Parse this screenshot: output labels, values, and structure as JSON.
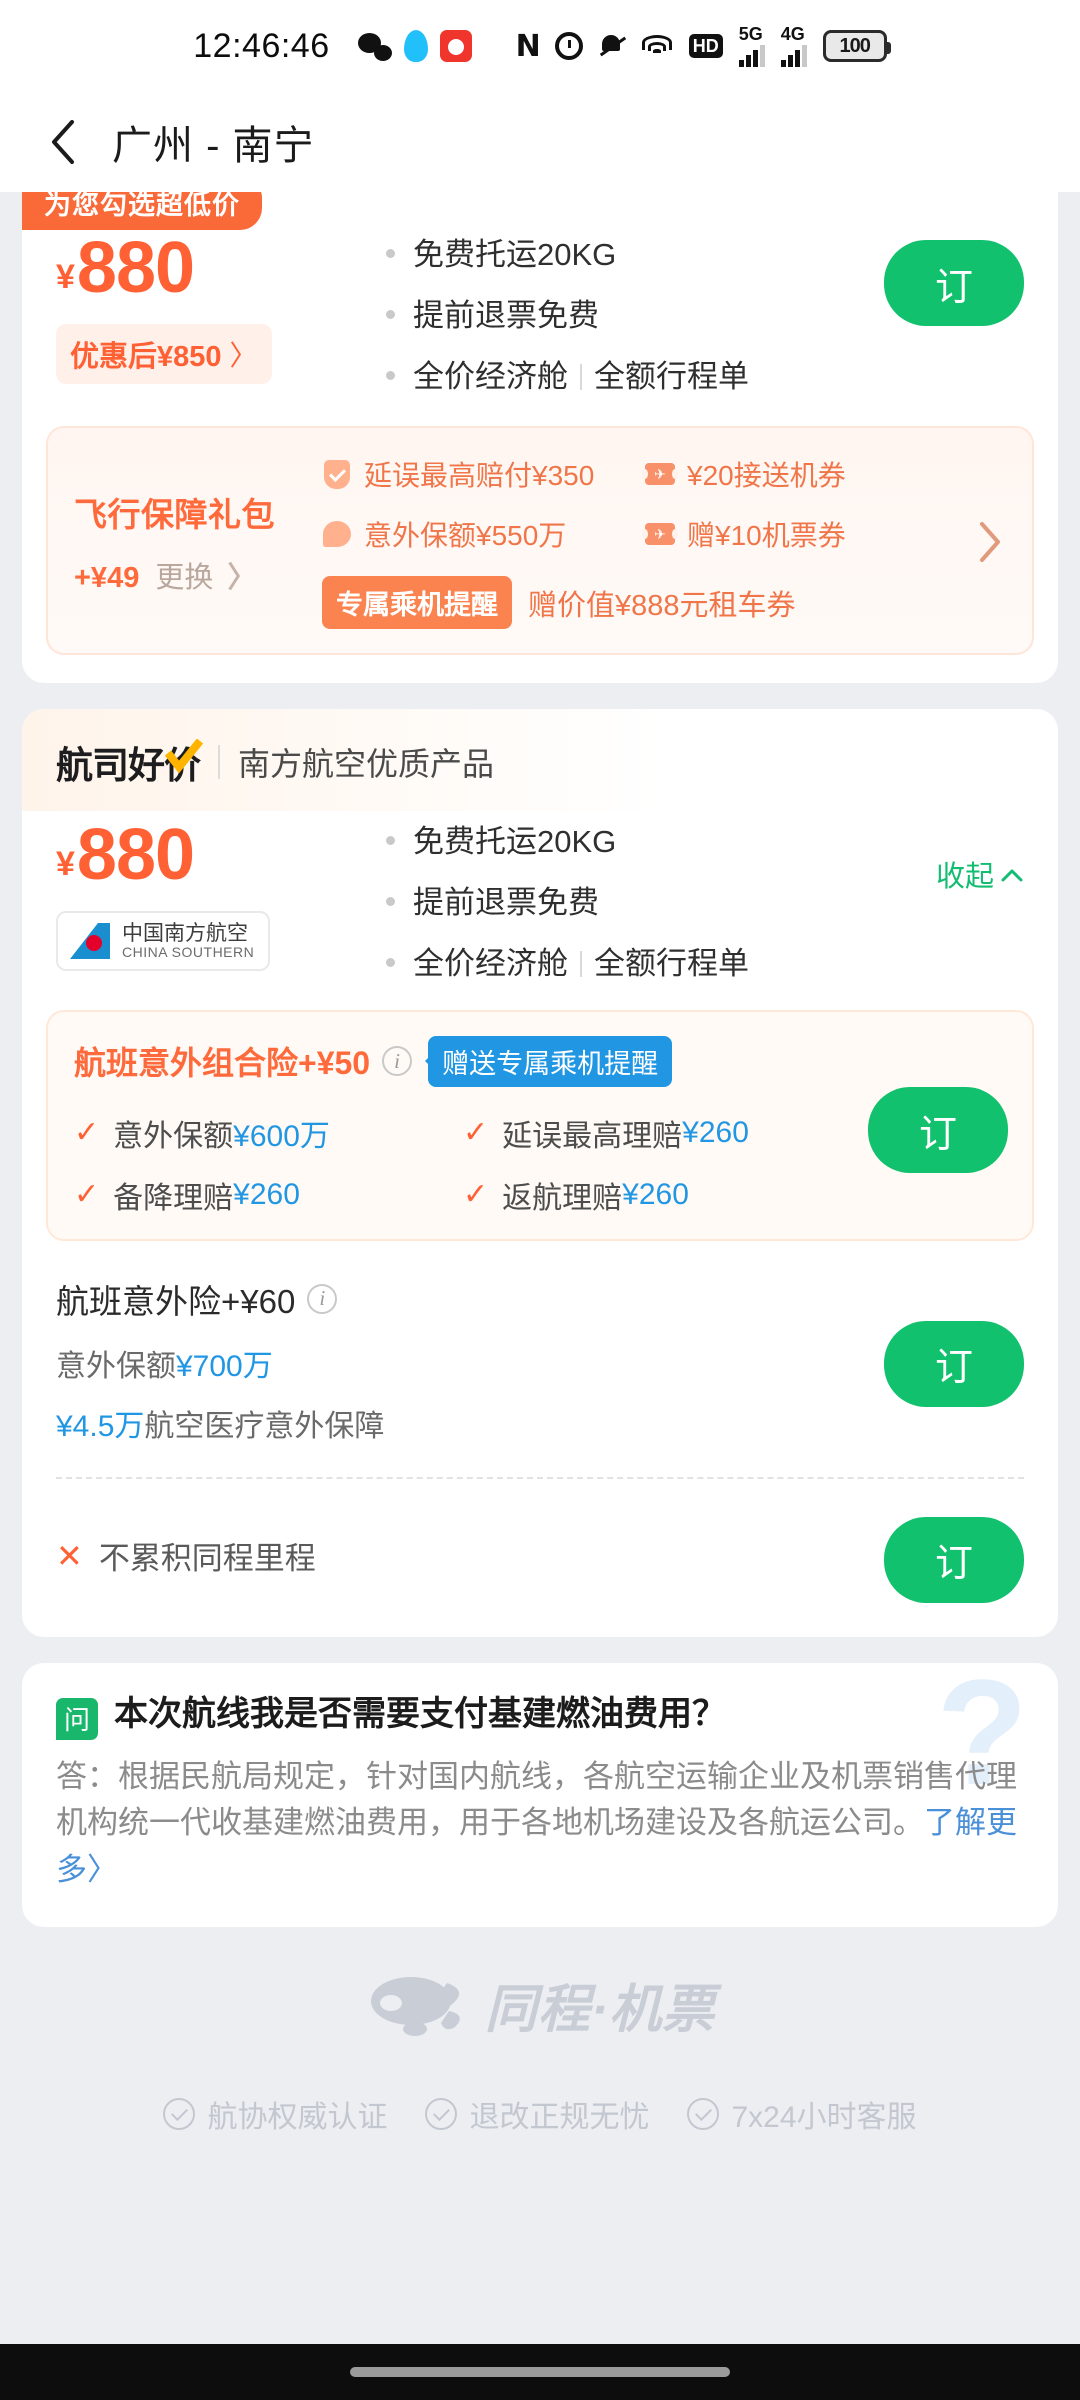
{
  "status_bar": {
    "time": "12:46:46",
    "battery": "100",
    "hd_label": "HD",
    "nfc_label": "N",
    "net_5g": "5G",
    "net_4g": "4G",
    "app_icons": [
      "wechat-icon",
      "qq-icon",
      "rednote-icon"
    ],
    "system_icons": [
      "nfc-icon",
      "alarm-icon",
      "mute-icon",
      "wifi-icon",
      "hd-volte-icon",
      "signal-5g-icon",
      "signal-4g-icon",
      "battery-icon"
    ]
  },
  "nav": {
    "back_icon": "back-chevron-icon",
    "title": "广州 - 南宁"
  },
  "fare_card_1": {
    "promo_tag": "为您勾选超低价",
    "currency": "¥",
    "price": "880",
    "discount_pill": "优惠后¥850",
    "discount_chevron": "〉",
    "features": [
      "免费托运20KG",
      "提前退票免费"
    ],
    "feature_split": {
      "left": "全价经济舱",
      "right": "全额行程单"
    },
    "book_label": "订",
    "gift": {
      "title": "飞行保障礼包",
      "price_add": "+¥49",
      "change_label": "更换",
      "change_chevron": "〉",
      "benefits": [
        {
          "icon": "shield-icon",
          "text": "延误最高赔付¥350"
        },
        {
          "icon": "coupon-icon",
          "text": "¥20接送机券"
        },
        {
          "icon": "umbrella-icon",
          "text": "意外保额¥550万"
        },
        {
          "icon": "coupon-icon",
          "text": "赠¥10机票券"
        }
      ],
      "chip": "专属乘机提醒",
      "bottom_text": "赠价值¥888元租车券",
      "arrow_icon": "chevron-right-icon"
    }
  },
  "fare_card_2": {
    "badge_text": "航司好价",
    "badge_sub": "南方航空优质产品",
    "currency": "¥",
    "price": "880",
    "airline": {
      "cn": "中国南方航空",
      "en": "CHINA SOUTHERN",
      "logo_icon": "china-southern-tail-icon"
    },
    "features": [
      "免费托运20KG",
      "提前退票免费"
    ],
    "feature_split": {
      "left": "全价经济舱",
      "right": "全额行程单"
    },
    "collapse_label": "收起",
    "collapse_icon": "chevron-up-icon",
    "insurance_combo": {
      "title": "航班意外组合险+¥50",
      "info_icon": "info-icon",
      "chip": "赠送专属乘机提醒",
      "items": [
        {
          "label": "意外保额",
          "value": "¥600万"
        },
        {
          "label": "延误最高理赔",
          "value": "¥260"
        },
        {
          "label": "备降理赔",
          "value": "¥260"
        },
        {
          "label": "返航理赔",
          "value": "¥260"
        }
      ],
      "book_label": "订"
    },
    "insurance_plain": {
      "title": "航班意外险+¥60",
      "info_icon": "info-icon",
      "line1_label": "意外保额",
      "line1_value": "¥700万",
      "line2_value": "¥4.5万",
      "line2_label": "航空医疗意外保障",
      "book_label": "订"
    },
    "miles_row": {
      "icon": "cross-icon",
      "text": "不累积同程里程",
      "book_label": "订"
    }
  },
  "faq": {
    "badge": "问",
    "question": "本次航线我是否需要支付基建燃油费用？",
    "answer": "答：根据民航局规定，针对国内航线，各航空运输企业及机票销售代理机构统一代收基建燃油费用，用于各地机场建设及各航运公司。",
    "more_label": "了解更多",
    "more_chevron": "〉",
    "watermark": "?"
  },
  "footer": {
    "brand": "同程·机票",
    "brand_icon": "tongcheng-logo-icon",
    "items": [
      "航协权威认证",
      "退改正规无忧",
      "7x24小时客服"
    ]
  },
  "colors": {
    "accent_orange": "#ff6034",
    "book_green": "#12c16e",
    "link_blue": "#2196e3",
    "page_bg": "#eceef2"
  }
}
